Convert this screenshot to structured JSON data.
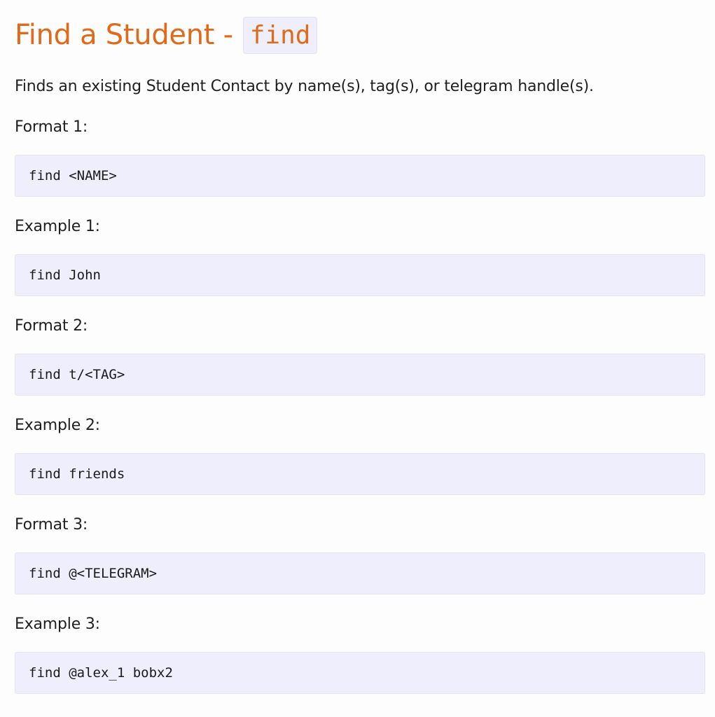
{
  "header": {
    "title": "Find a Student -",
    "command": "find"
  },
  "intro": "Finds an existing Student Contact by name(s), tag(s), or telegram handle(s).",
  "sections": [
    {
      "label": "Format 1:",
      "code": "find <NAME>"
    },
    {
      "label": "Example 1:",
      "code": "find John"
    },
    {
      "label": "Format 2:",
      "code": "find t/<TAG>"
    },
    {
      "label": "Example 2:",
      "code": "find friends"
    },
    {
      "label": "Format 3:",
      "code": "find @<TELEGRAM>"
    },
    {
      "label": "Example 3:",
      "code": "find @alex_1 bobx2"
    }
  ],
  "colors": {
    "heading": "#e0691a",
    "code_background": "#efeefc",
    "page_background": "#fdfdfd"
  }
}
